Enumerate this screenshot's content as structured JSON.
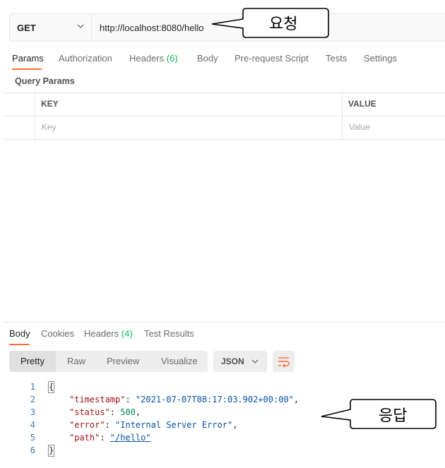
{
  "request": {
    "method": "GET",
    "url": "http://localhost:8080/hello"
  },
  "request_tabs": [
    {
      "label": "Params"
    },
    {
      "label": "Authorization"
    },
    {
      "label": "Headers",
      "count": "(6)"
    },
    {
      "label": "Body"
    },
    {
      "label": "Pre-request Script"
    },
    {
      "label": "Tests"
    },
    {
      "label": "Settings"
    }
  ],
  "query_params": {
    "label": "Query Params",
    "columns": {
      "key": "KEY",
      "value": "VALUE"
    },
    "placeholders": {
      "key": "Key",
      "value": "Value"
    }
  },
  "response_tabs": [
    {
      "label": "Body"
    },
    {
      "label": "Cookies"
    },
    {
      "label": "Headers",
      "count": "(4)"
    },
    {
      "label": "Test Results"
    }
  ],
  "view_modes": [
    "Pretty",
    "Raw",
    "Preview",
    "Visualize"
  ],
  "format": "JSON",
  "response_body": {
    "line_numbers": [
      "1",
      "2",
      "3",
      "4",
      "5",
      "6"
    ],
    "open_brace": "{",
    "close_brace": "}",
    "fields": [
      {
        "key": "\"timestamp\"",
        "value": "\"2021-07-07T08:17:03.902+00:00\"",
        "sep": ","
      },
      {
        "key": "\"status\"",
        "value": "500",
        "sep": ","
      },
      {
        "key": "\"error\"",
        "value": "\"Internal Server Error\"",
        "sep": ","
      },
      {
        "key": "\"path\"",
        "value": "\"/hello\"",
        "sep": ""
      }
    ]
  },
  "annotations": {
    "request": "요청",
    "response": "응답"
  },
  "colors": {
    "accent": "#ff6c37",
    "count_green": "#0cbb52"
  }
}
